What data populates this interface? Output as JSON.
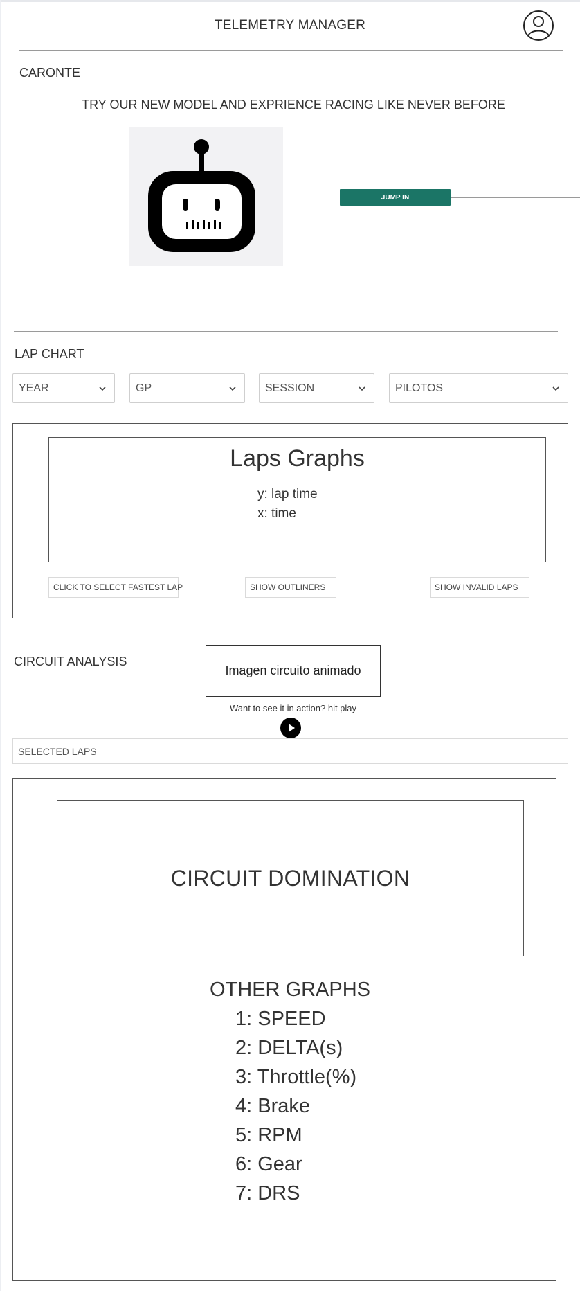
{
  "header": {
    "title": "TELEMETRY MANAGER"
  },
  "caronte": {
    "section_label": "CARONTE",
    "promo_text": "TRY OUR NEW MODEL AND EXPRIENCE RACING LIKE NEVER BEFORE",
    "jump_button": "JUMP IN",
    "icon": "robot-icon"
  },
  "lap_chart": {
    "section_label": "LAP CHART",
    "filters": [
      {
        "label": "YEAR"
      },
      {
        "label": "GP"
      },
      {
        "label": "SESSION"
      },
      {
        "label": "PILOTOS"
      }
    ],
    "graph": {
      "title": "Laps Graphs",
      "y_text": "y: lap time",
      "x_text": "x: time"
    },
    "buttons": {
      "fastest": "CLICK TO SELECT FASTEST LAP",
      "outliners": "SHOW OUTLINERS",
      "invalid": "SHOW INVALID LAPS"
    }
  },
  "circuit_analysis": {
    "section_label": "CIRCUIT ANALYSIS",
    "image_placeholder": "Imagen circuito animado",
    "see_action": "Want to see it in action? hit play",
    "selected_laps": "SELECTED LAPS",
    "domination_title": "CIRCUIT DOMINATION",
    "other_graphs_title": "OTHER GRAPHS",
    "other_graphs": [
      "1: SPEED",
      "2: DELTA(s)",
      "3: Throttle(%)",
      "4: Brake",
      "5: RPM",
      "6: Gear",
      "7: DRS"
    ]
  },
  "colors": {
    "accent": "#1b7566",
    "border": "#555555",
    "text": "#333333"
  }
}
